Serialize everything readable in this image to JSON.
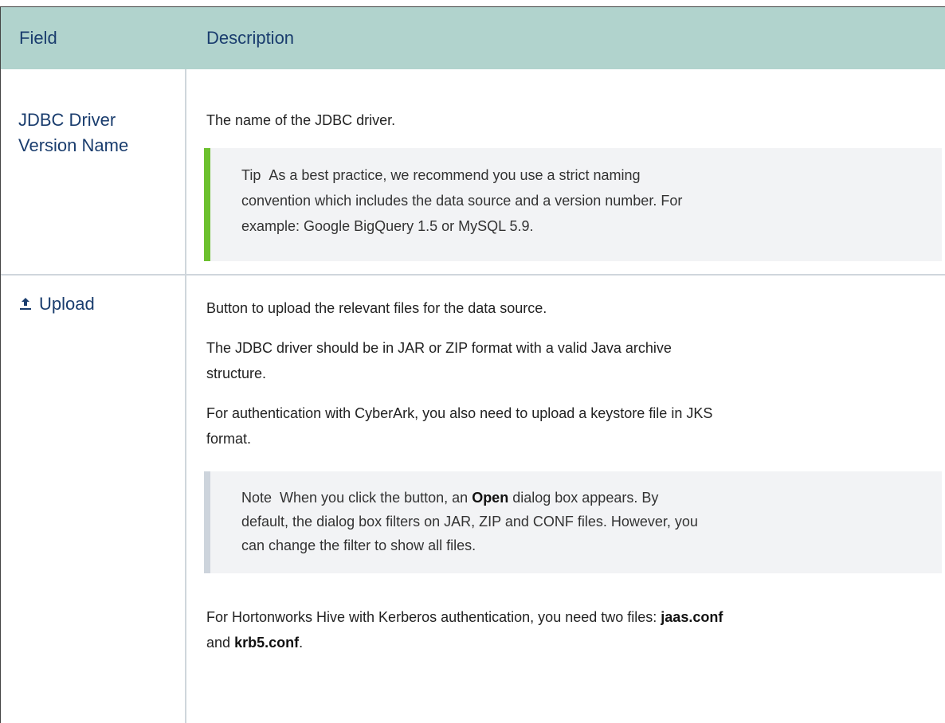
{
  "table": {
    "header": {
      "field": "Field",
      "description": "Description"
    },
    "rows": [
      {
        "field": "JDBC Driver Version Name",
        "field_line1": "JDBC Driver",
        "field_line2": "Version Name",
        "description": "The name of the JDBC driver.",
        "callout": {
          "type": "Tip",
          "text": "As a best practice, we recommend you use a strict naming convention which includes the data source and a version number. For example: Google BigQuery 1.5 or MySQL 5.9.",
          "line1": "As a best practice, we recommend you use a strict naming",
          "line2": "convention which includes the data source and a version number. For",
          "line3": "example: Google BigQuery 1.5 or MySQL 5.9."
        }
      },
      {
        "field": "Upload",
        "field_icon": "upload-icon",
        "p1": "Button to upload the relevant files for the data source.",
        "p2_line1": "The JDBC driver should be in JAR or ZIP format with a valid Java archive",
        "p2_line2": "structure.",
        "p3_line1": "For authentication with CyberArk, you also need to upload a keystore file in JKS",
        "p3_line2": "format.",
        "callout": {
          "type": "Note",
          "before_open": "When you click the button, an",
          "open": "Open",
          "after_open": "dialog box appears. By",
          "line2": "default, the dialog box filters on JAR, ZIP and CONF files. However, you",
          "line3": "can change the filter to show all files."
        },
        "p4_before": "For Hortonworks Hive with Kerberos authentication, you need two files:",
        "p4_file1": "jaas.conf",
        "p4_and": "and",
        "p4_file2": "krb5.conf",
        "p4_end": "."
      }
    ]
  },
  "colors": {
    "header_bg": "#b1d3cd",
    "header_text": "#1a3d6e",
    "tip_accent": "#6cc02e",
    "note_accent": "#cdd4dc",
    "callout_bg": "#f2f3f5"
  }
}
